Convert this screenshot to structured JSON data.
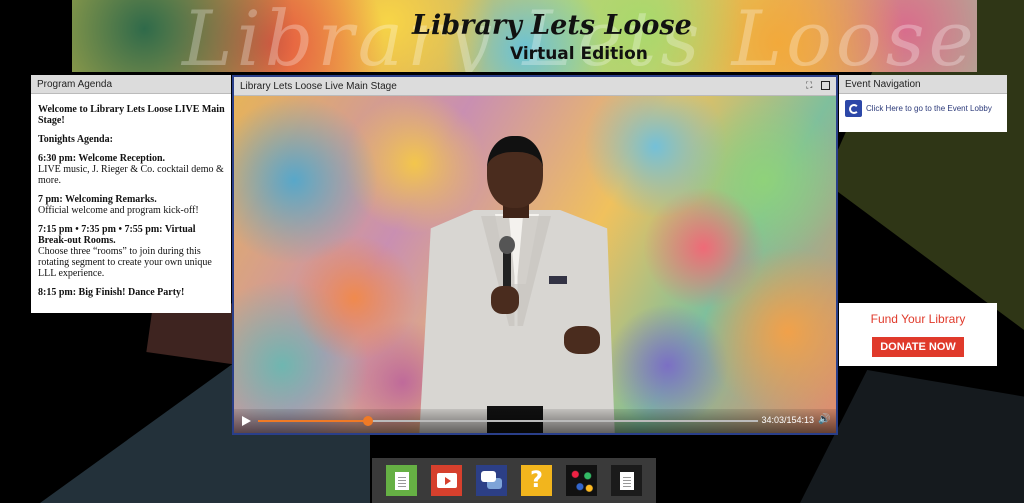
{
  "banner": {
    "ghost_text": "Library Lets Loose",
    "title": "Library Lets Loose",
    "subtitle": "Virtual Edition"
  },
  "agenda": {
    "header": "Program Agenda",
    "welcome": "Welcome to Library Lets Loose LIVE Main Stage!",
    "tonight": "Tonights Agenda:",
    "items": [
      {
        "time": "6:30 pm: Welcome Reception.",
        "desc": "LIVE music, J. Rieger & Co. cocktail demo & more."
      },
      {
        "time": "7 pm: Welcoming Remarks.",
        "desc": "Official welcome and program kick-off!"
      },
      {
        "time": "7:15 pm • 7:35 pm • 7:55 pm: Virtual Break-out Rooms.",
        "desc": "Choose three “rooms” to join during this rotating segment to create your own unique LLL experience."
      },
      {
        "time": "8:15 pm: Big Finish! Dance Party!",
        "desc": ""
      }
    ]
  },
  "stage": {
    "header": "Library Lets Loose Live Main Stage",
    "time_display": "34:03/154:13",
    "progress": 0.22
  },
  "nav": {
    "header": "Event Navigation",
    "lobby_link": "Click Here to go to the Event Lobby"
  },
  "fund": {
    "title": "Fund Your Library",
    "button": "DONATE NOW"
  },
  "toolbar": {
    "icons": [
      "document-icon",
      "video-icon",
      "chat-icon",
      "help-icon",
      "game-icon",
      "page-icon"
    ],
    "help_glyph": "?"
  }
}
